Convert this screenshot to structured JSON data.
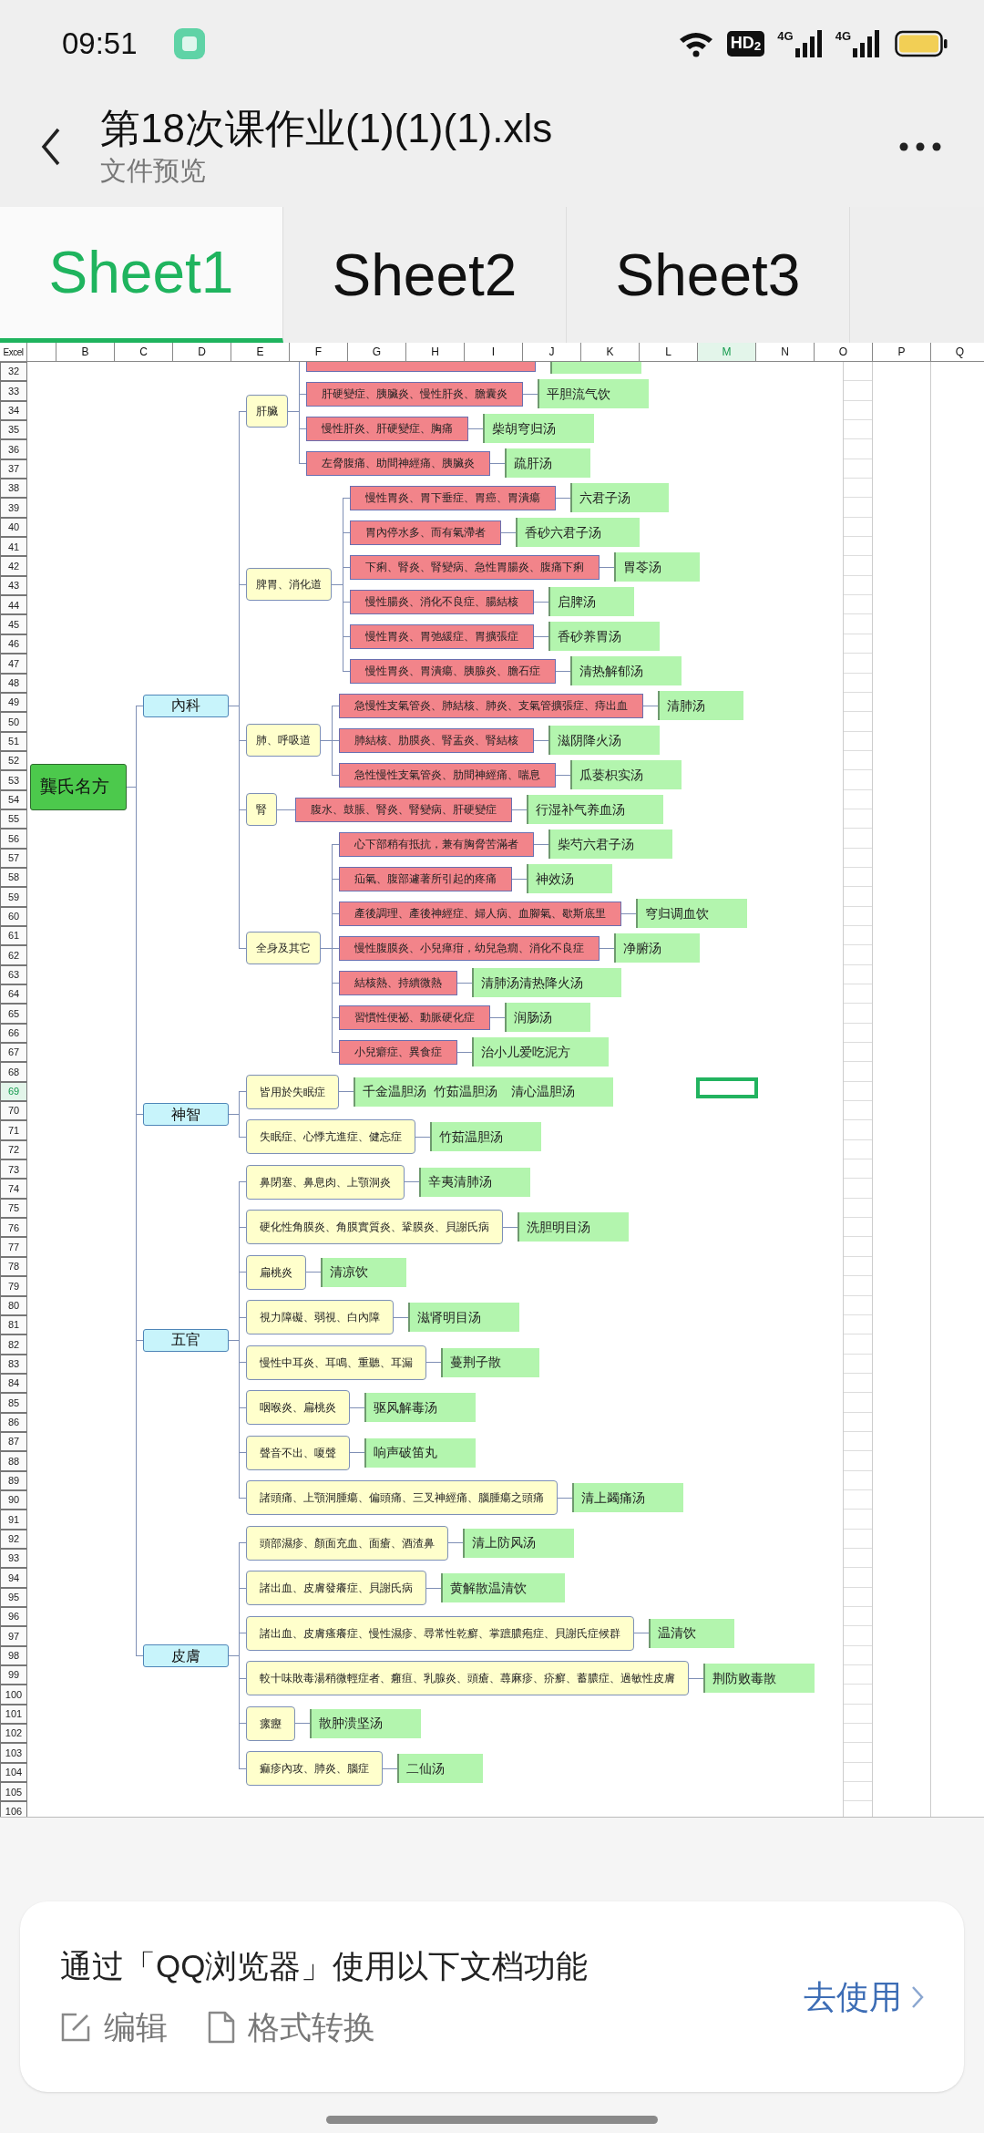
{
  "status_bar": {
    "time": "09:51",
    "hd": "HD$_{2}$",
    "signals": [
      {
        "label": "4G"
      },
      {
        "label": "4G"
      }
    ]
  },
  "header": {
    "title": "第18次课作业(1)(1)(1).xls",
    "subtitle": "文件预览"
  },
  "tabs": [
    {
      "label": "Sheet1",
      "selected": true
    },
    {
      "label": "Sheet2",
      "selected": false
    },
    {
      "label": "Sheet3",
      "selected": false
    }
  ],
  "sheet": {
    "corner": "Excel",
    "columns": [
      {
        "label": "B",
        "selected": false
      },
      {
        "label": "C",
        "selected": false
      },
      {
        "label": "D",
        "selected": false
      },
      {
        "label": "E",
        "selected": false
      },
      {
        "label": "F",
        "selected": false
      },
      {
        "label": "G",
        "selected": false
      },
      {
        "label": "H",
        "selected": false
      },
      {
        "label": "I",
        "selected": false
      },
      {
        "label": "J",
        "selected": false
      },
      {
        "label": "K",
        "selected": false
      },
      {
        "label": "L",
        "selected": false
      },
      {
        "label": "M",
        "selected": true
      },
      {
        "label": "N",
        "selected": false
      },
      {
        "label": "O",
        "selected": false
      },
      {
        "label": "P",
        "selected": false
      },
      {
        "label": "Q",
        "selected": false
      }
    ],
    "rows": [
      {
        "label": "32",
        "selected": false
      },
      {
        "label": "33",
        "selected": false
      },
      {
        "label": "34",
        "selected": false
      },
      {
        "label": "35",
        "selected": false
      },
      {
        "label": "36",
        "selected": false
      },
      {
        "label": "37",
        "selected": false
      },
      {
        "label": "38",
        "selected": false
      },
      {
        "label": "39",
        "selected": false
      },
      {
        "label": "40",
        "selected": false
      },
      {
        "label": "41",
        "selected": false
      },
      {
        "label": "42",
        "selected": false
      },
      {
        "label": "43",
        "selected": false
      },
      {
        "label": "44",
        "selected": false
      },
      {
        "label": "45",
        "selected": false
      },
      {
        "label": "46",
        "selected": false
      },
      {
        "label": "47",
        "selected": false
      },
      {
        "label": "48",
        "selected": false
      },
      {
        "label": "49",
        "selected": false
      },
      {
        "label": "50",
        "selected": false
      },
      {
        "label": "51",
        "selected": false
      },
      {
        "label": "52",
        "selected": false
      },
      {
        "label": "53",
        "selected": false
      },
      {
        "label": "54",
        "selected": false
      },
      {
        "label": "55",
        "selected": false
      },
      {
        "label": "56",
        "selected": false
      },
      {
        "label": "57",
        "selected": false
      },
      {
        "label": "58",
        "selected": false
      },
      {
        "label": "59",
        "selected": false
      },
      {
        "label": "60",
        "selected": false
      },
      {
        "label": "61",
        "selected": false
      },
      {
        "label": "62",
        "selected": false
      },
      {
        "label": "63",
        "selected": false
      },
      {
        "label": "64",
        "selected": false
      },
      {
        "label": "65",
        "selected": false
      },
      {
        "label": "66",
        "selected": false
      },
      {
        "label": "67",
        "selected": false
      },
      {
        "label": "68",
        "selected": false
      },
      {
        "label": "69",
        "selected": true
      },
      {
        "label": "70",
        "selected": false
      },
      {
        "label": "71",
        "selected": false
      },
      {
        "label": "72",
        "selected": false
      },
      {
        "label": "73",
        "selected": false
      },
      {
        "label": "74",
        "selected": false
      },
      {
        "label": "75",
        "selected": false
      },
      {
        "label": "76",
        "selected": false
      },
      {
        "label": "77",
        "selected": false
      },
      {
        "label": "78",
        "selected": false
      },
      {
        "label": "79",
        "selected": false
      },
      {
        "label": "80",
        "selected": false
      },
      {
        "label": "81",
        "selected": false
      },
      {
        "label": "82",
        "selected": false
      },
      {
        "label": "83",
        "selected": false
      },
      {
        "label": "84",
        "selected": false
      },
      {
        "label": "85",
        "selected": false
      },
      {
        "label": "86",
        "selected": false
      },
      {
        "label": "87",
        "selected": false
      },
      {
        "label": "88",
        "selected": false
      },
      {
        "label": "89",
        "selected": false
      },
      {
        "label": "90",
        "selected": false
      },
      {
        "label": "91",
        "selected": false
      },
      {
        "label": "92",
        "selected": false
      },
      {
        "label": "93",
        "selected": false
      },
      {
        "label": "94",
        "selected": false
      },
      {
        "label": "95",
        "selected": false
      },
      {
        "label": "96",
        "selected": false
      },
      {
        "label": "97",
        "selected": false
      },
      {
        "label": "98",
        "selected": false
      },
      {
        "label": "99",
        "selected": false
      },
      {
        "label": "100",
        "selected": false
      },
      {
        "label": "101",
        "selected": false
      },
      {
        "label": "102",
        "selected": false
      },
      {
        "label": "103",
        "selected": false
      },
      {
        "label": "104",
        "selected": false
      },
      {
        "label": "105",
        "selected": false
      },
      {
        "label": "106",
        "selected": false
      }
    ],
    "mind_map": {
      "root": "龔氏名方",
      "categories": [
        {
          "label": "內科",
          "children": [
            {
              "kind": "group",
              "label": "肝臟",
              "children": [
                {
                  "kind": "cut"
                },
                {
                  "kind": "item",
                  "condition": "肝硬變症、胰臟炎、慢性肝炎、膽囊炎",
                  "formula": "平胆流气饮"
                },
                {
                  "kind": "item",
                  "condition": "慢性肝炎、肝硬變症、胸痛",
                  "formula": "柴胡穹归汤"
                },
                {
                  "kind": "item",
                  "condition": "左脅腹痛、助間神經痛、胰臟炎",
                  "formula": "疏肝汤"
                }
              ]
            },
            {
              "kind": "group",
              "label": "脾胃、消化道",
              "children": [
                {
                  "kind": "item",
                  "condition": "慢性胃炎、胃下垂症、胃癌、胃潰瘍",
                  "formula": "六君子汤"
                },
                {
                  "kind": "item",
                  "condition": "胃內停水多、而有氣滯者",
                  "formula": "香砂六君子汤"
                },
                {
                  "kind": "item",
                  "condition": "下痢、腎炎、腎變病、急性胃腸炎、腹痛下痢",
                  "formula": "胃苓汤"
                },
                {
                  "kind": "item",
                  "condition": "慢性腸炎、消化不良症、腸結核",
                  "formula": "启脾汤"
                },
                {
                  "kind": "item",
                  "condition": "慢性胃炎、胃弛緩症、胃擴張症",
                  "formula": "香砂养胃汤"
                },
                {
                  "kind": "item",
                  "condition": "慢性胃炎、胃潰瘍、胰腺炎、膽石症",
                  "formula": "清热解郁汤"
                }
              ]
            },
            {
              "kind": "group",
              "label": "肺、呼吸道",
              "children": [
                {
                  "kind": "item",
                  "condition": "急慢性支氣管炎、肺結核、肺炎、支氣管擴張症、痔出血",
                  "formula": "清肺汤"
                },
                {
                  "kind": "item",
                  "condition": "肺結核、肋膜炎、腎盂炎、腎結核",
                  "formula": "滋阴降火汤"
                },
                {
                  "kind": "item",
                  "condition": "急性慢性支氣管炎、肋間神經痛、喘息",
                  "formula": "瓜蒌枳实汤"
                }
              ]
            },
            {
              "kind": "group",
              "label": "腎",
              "children": [
                {
                  "kind": "item",
                  "condition": "腹水、鼓脹、腎炎、腎變病、肝硬變症",
                  "formula": "行湿补气养血汤"
                }
              ]
            },
            {
              "kind": "group",
              "label": "全身及其它",
              "children": [
                {
                  "kind": "item",
                  "condition": "心下部稍有抵抗，兼有胸脅苦滿者",
                  "formula": "柴芍六君子汤"
                },
                {
                  "kind": "item",
                  "condition": "疝氣、腹部遽著所引起的疼痛",
                  "formula": "神效汤"
                },
                {
                  "kind": "item",
                  "condition": "產後調理、產後神經症、婦人病、血腳氣、歇斯底里",
                  "formula": "穹归调血饮"
                },
                {
                  "kind": "item",
                  "condition": "慢性腹膜炎、小兒瘅疳，幼兒急癇、消化不良症",
                  "formula": "净腑汤"
                },
                {
                  "kind": "item",
                  "condition": "結核熱、持續微熱",
                  "formula": "清肺汤清热降火汤"
                },
                {
                  "kind": "item",
                  "condition": "習慣性便祕、動脈硬化症",
                  "formula": "润肠汤"
                },
                {
                  "kind": "item",
                  "condition": "小兒癖症、異食症",
                  "formula": "治小儿爱吃泥方"
                }
              ]
            }
          ]
        },
        {
          "label": "神智",
          "children": [
            {
              "kind": "item",
              "condition": "皆用於失眠症",
              "formula": "千金温胆汤  竹茹温胆汤    清心温胆汤"
            },
            {
              "kind": "item",
              "condition": "失眠症、心悸亢進症、健忘症",
              "formula": "竹茹温胆汤"
            }
          ]
        },
        {
          "label": "五官",
          "children": [
            {
              "kind": "item",
              "condition": "鼻閉塞、鼻息肉、上顎洞炎",
              "formula": "辛夷清肺汤"
            },
            {
              "kind": "item",
              "condition": "硬化性角膜炎、角膜實質炎、鞏膜炎、貝謝氏病",
              "formula": "洗胆明目汤"
            },
            {
              "kind": "item",
              "condition": "扁桃炎",
              "formula": "清凉饮"
            },
            {
              "kind": "item",
              "condition": "視力障礙、弱視、白內障",
              "formula": "滋肾明目汤"
            },
            {
              "kind": "item",
              "condition": "慢性中耳炎、耳鳴、重聽、耳漏",
              "formula": "蔓荆子散"
            },
            {
              "kind": "item",
              "condition": "咽喉炎、扁桃炎",
              "formula": "驱风解毒汤"
            },
            {
              "kind": "item",
              "condition": "聲音不出、嗄聲",
              "formula": "响声破笛丸"
            },
            {
              "kind": "item",
              "condition": "諸頭痛、上顎洞腫瘍、偏頭痛、三叉神經痛、腦腫瘍之頭痛",
              "formula": "清上蠲痛汤"
            }
          ]
        },
        {
          "label": "皮膚",
          "children": [
            {
              "kind": "item",
              "condition": "頭部濕疹、顏面充血、面瘡、酒渣鼻",
              "formula": "清上防风汤"
            },
            {
              "kind": "item",
              "condition": "諸出血、皮膚發癢症、貝謝氏病",
              "formula": "黄解散温清饮"
            },
            {
              "kind": "item",
              "condition": "諸出血、皮膚瘙癢症、慢性濕疹、尋常性乾癬、掌蹠膿疱症、貝謝氏症候群",
              "formula": "温清饮"
            },
            {
              "kind": "item",
              "condition": "較十味敗毒湯稍微輕症者、癰疽、乳腺炎、頭瘡、蕁麻疹、疥癬、蓄膿症、過敏性皮膚",
              "formula": "荆防败毒散"
            },
            {
              "kind": "item",
              "condition": "瘰癧",
              "formula": "散肿溃坚汤"
            },
            {
              "kind": "item",
              "condition": "痲疹內攻、肺炎、腦症",
              "formula": "二仙汤"
            }
          ]
        }
      ]
    }
  },
  "banner": {
    "message": "通过「QQ浏览器」使用以下文档功能",
    "actions": [
      {
        "kind": "edit",
        "label": "编辑"
      },
      {
        "kind": "convert",
        "label": "格式转换"
      }
    ],
    "button": "去使用"
  }
}
